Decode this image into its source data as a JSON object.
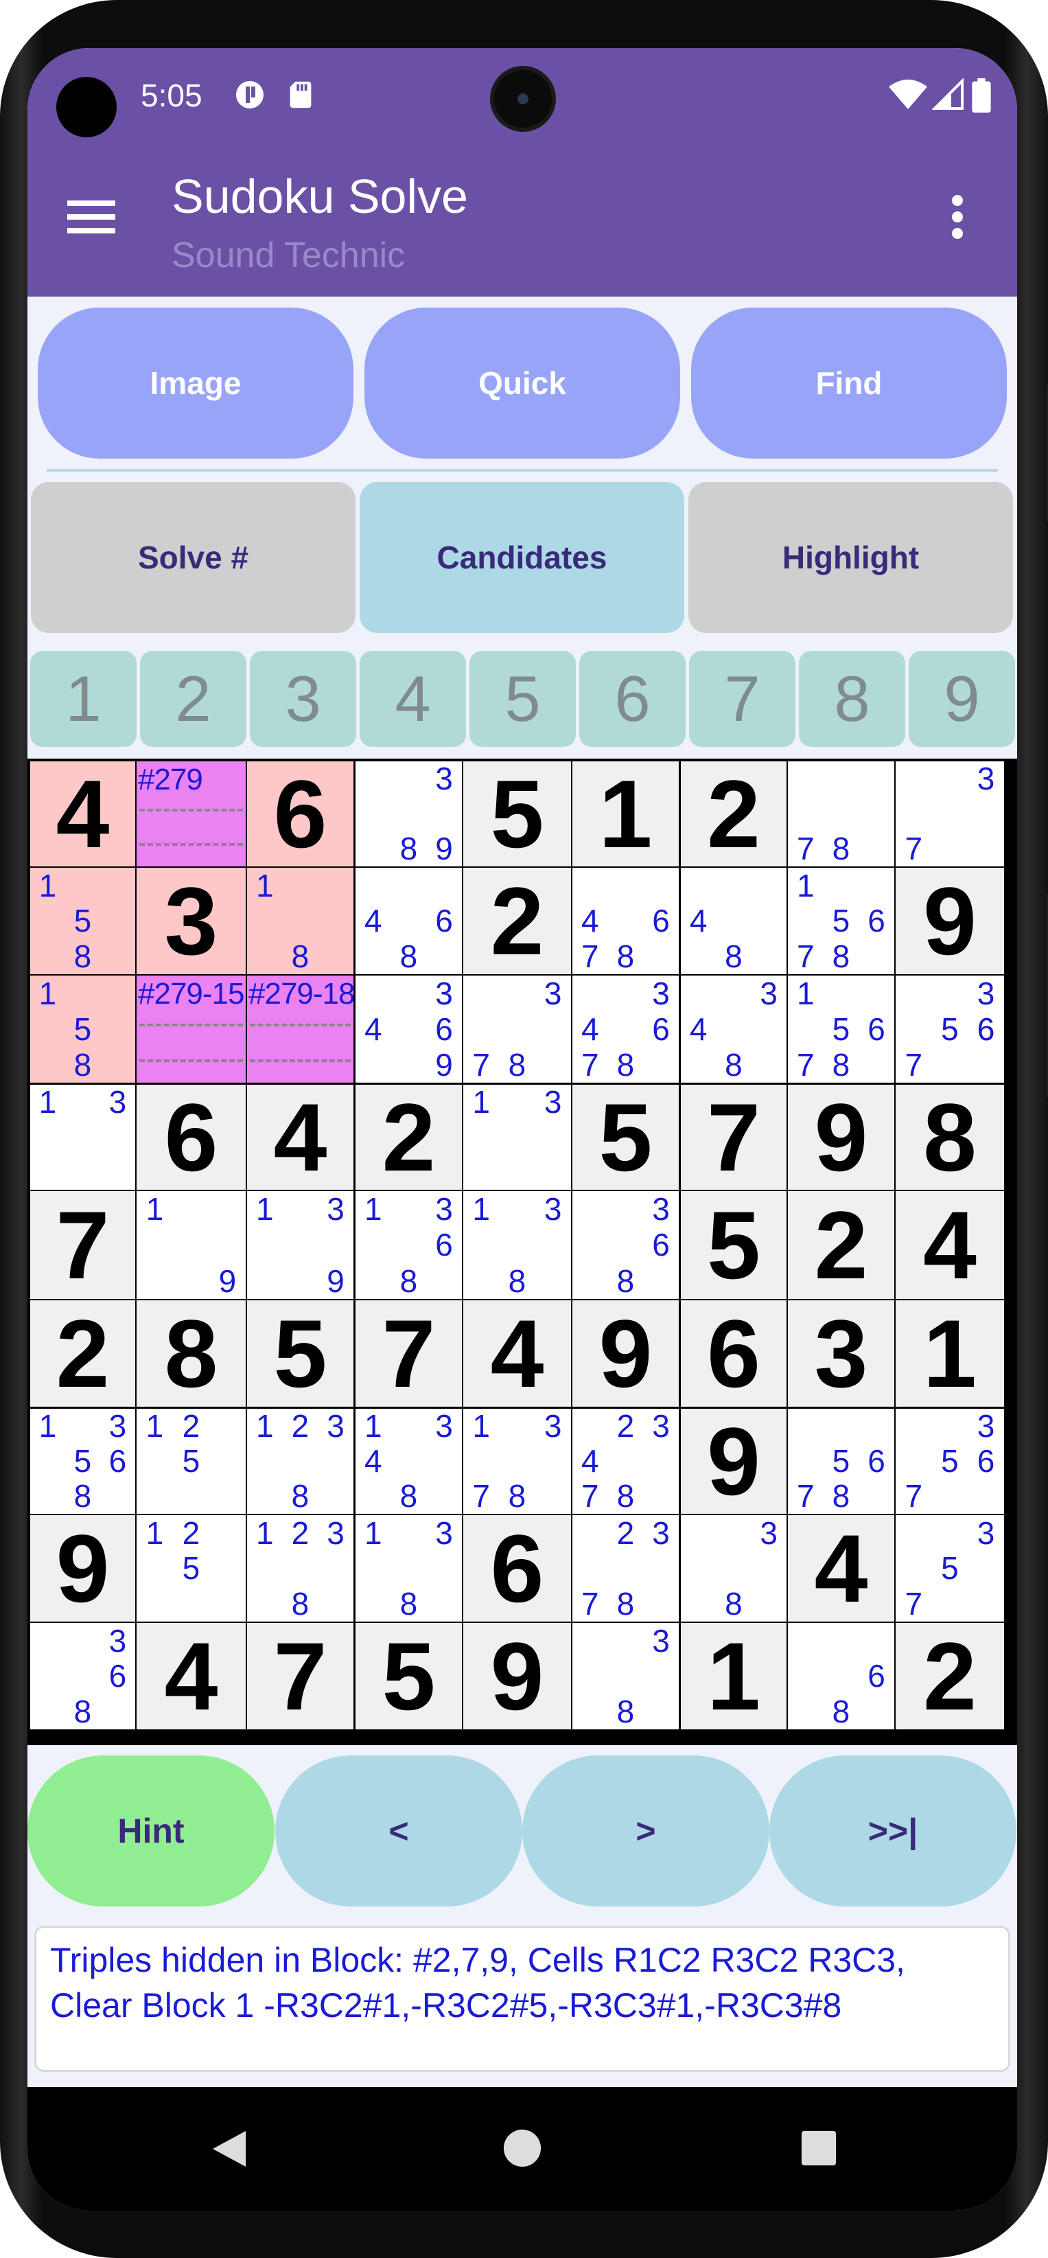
{
  "status": {
    "time": "5:05",
    "icons": [
      "dnd-icon",
      "sd-card-icon",
      "wifi-icon",
      "signal-icon",
      "battery-icon"
    ]
  },
  "appbar": {
    "title": "Sudoku Solve",
    "subtitle": "Sound Technic"
  },
  "row1": {
    "image": "Image",
    "quick": "Quick",
    "find": "Find"
  },
  "row2": {
    "solve": "Solve #",
    "candidates": "Candidates",
    "highlight": "Highlight"
  },
  "numbers": [
    "1",
    "2",
    "3",
    "4",
    "5",
    "6",
    "7",
    "8",
    "9"
  ],
  "grid": {
    "rows": [
      [
        "4",
        "",
        "6",
        "",
        "5",
        "1",
        "2",
        "",
        ""
      ],
      [
        "",
        "3",
        "",
        "",
        "2",
        "",
        "",
        "",
        "9"
      ],
      [
        "",
        "",
        "",
        "",
        "",
        "",
        "",
        "",
        ""
      ],
      [
        "",
        "6",
        "4",
        "2",
        "",
        "5",
        "7",
        "9",
        "8"
      ],
      [
        "7",
        "",
        "",
        "",
        "",
        "",
        "5",
        "2",
        "4"
      ],
      [
        "2",
        "8",
        "5",
        "7",
        "4",
        "9",
        "6",
        "3",
        "1"
      ],
      [
        "",
        "",
        "",
        "",
        "",
        "",
        "9",
        "",
        ""
      ],
      [
        "9",
        "",
        "",
        "",
        "6",
        "",
        "",
        "4",
        ""
      ],
      [
        "",
        "4",
        "7",
        "5",
        "9",
        "",
        "1",
        "",
        "2"
      ]
    ],
    "candidates": [
      [
        "",
        "#279",
        "",
        "3 89",
        "",
        "",
        "",
        "78",
        "3 7"
      ],
      [
        "158",
        "",
        "18",
        "46 8",
        "",
        "46 78",
        "4 8",
        "156 78",
        ""
      ],
      [
        "158",
        "#279-15",
        "#279-18",
        "3 469",
        "3 78",
        "36 478",
        "3 48",
        "156 78",
        "36 567"
      ],
      [
        "13",
        "",
        "",
        "",
        "13",
        "",
        "",
        "",
        ""
      ],
      [
        "",
        "19",
        "139",
        "136 8",
        "13 8",
        "36 8",
        "",
        "",
        ""
      ],
      [
        "",
        "",
        "",
        "",
        "",
        "",
        "",
        "",
        ""
      ],
      [
        "1356 8",
        "125",
        "1238",
        "134 8",
        "13 78",
        "23 478",
        "",
        "56 78",
        "36 57"
      ],
      [
        "",
        "125",
        "1238",
        "13 8",
        "",
        "23 78",
        "3 8",
        "",
        "3 57"
      ],
      [
        "36 8",
        "",
        "",
        "",
        "",
        "3 8",
        "",
        "6 8",
        ""
      ]
    ],
    "highlight_colors": {
      "block": "#ffc8c8",
      "triple": "#ea82f2",
      "given": "#f0f0f0"
    }
  },
  "bottom": {
    "hint": "Hint",
    "prev": "<",
    "next": ">",
    "end": ">>|"
  },
  "message": "Triples hidden in Block: #2,7,9, Cells R1C2 R3C2 R3C3, Clear Block 1 -R3C2#1,-R3C2#5,-R3C3#1,-R3C3#8"
}
